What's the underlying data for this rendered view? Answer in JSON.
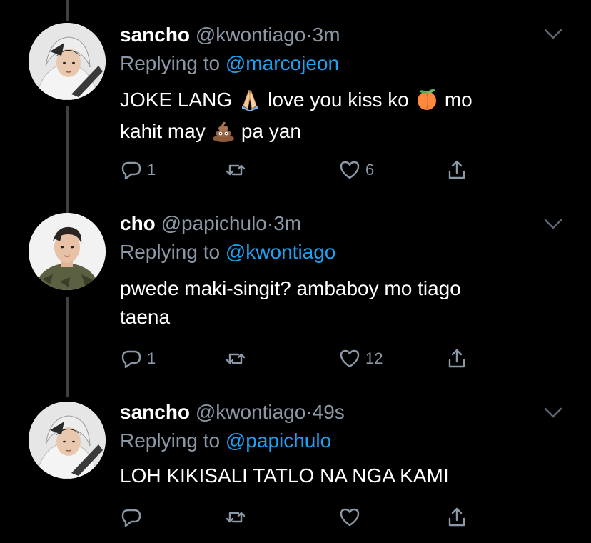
{
  "tweets": [
    {
      "name": "sancho",
      "handle": "@kwontiago",
      "dot": "·",
      "time": "3m",
      "replying_prefix": "Replying to",
      "replying_to": "@marcojeon",
      "line1_a": "JOKE LANG",
      "line1_b": "love you kiss ko",
      "line1_c": "mo",
      "line2_a": "kahit may",
      "line2_b": "pa yan",
      "emojis": [
        "folded-hands-icon",
        "peach-icon",
        "poop-icon"
      ],
      "reply_count": "1",
      "retweet_count": "",
      "like_count": "6"
    },
    {
      "name": "cho",
      "handle": "@papichulo",
      "dot": "·",
      "time": "3m",
      "replying_prefix": "Replying to",
      "replying_to": "@kwontiago",
      "line1": "pwede maki-singit? ambaboy mo tiago",
      "line2": "taena",
      "reply_count": "1",
      "retweet_count": "",
      "like_count": "12"
    },
    {
      "name": "sancho",
      "handle": "@kwontiago",
      "dot": "·",
      "time": "49s",
      "replying_prefix": "Replying to",
      "replying_to": "@papichulo",
      "line1": "LOH KIKISALI TATLO NA NGA KAMI",
      "reply_count": "",
      "retweet_count": "",
      "like_count": ""
    }
  ],
  "colors": {
    "background": "#000000",
    "secondary": "#8b98a5",
    "accent": "#1da1f2",
    "thread_line": "#3d4145"
  }
}
